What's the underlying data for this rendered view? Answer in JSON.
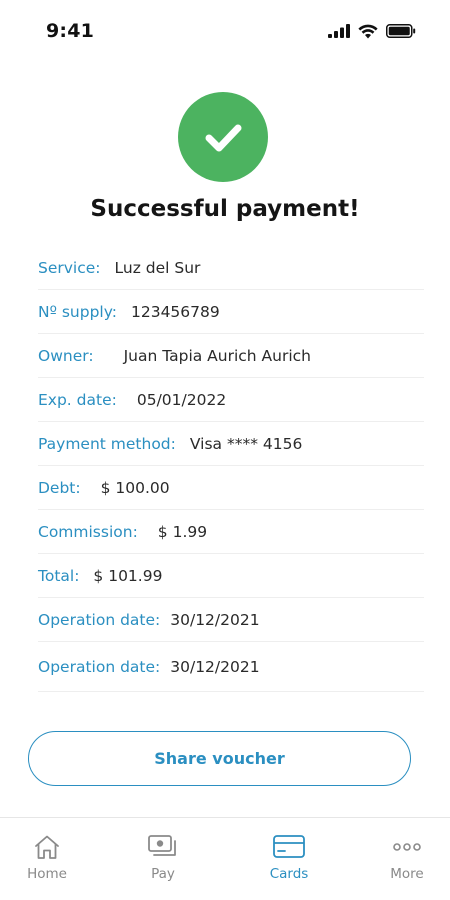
{
  "status_bar": {
    "time": "9:41"
  },
  "title": "Successful payment!",
  "details": [
    {
      "label": "Service:",
      "value": "Luz del Sur"
    },
    {
      "label": "Nº supply:",
      "value": "123456789"
    },
    {
      "label": "Owner:",
      "value": "Juan Tapia Aurich Aurich"
    },
    {
      "label": "Exp. date:",
      "value": "05/01/2022"
    },
    {
      "label": "Payment method:",
      "value": "Visa **** 4156"
    },
    {
      "label": "Debt:",
      "value": "$ 100.00"
    },
    {
      "label": "Commission:",
      "value": "$ 1.99"
    },
    {
      "label": "Total:",
      "value": "$ 101.99"
    },
    {
      "label": "Operation date:",
      "value": "30/12/2021"
    },
    {
      "label": "Operation date:",
      "value": "30/12/2021"
    }
  ],
  "share_button": {
    "label": "Share voucher"
  },
  "nav": {
    "items": [
      {
        "label": "Home",
        "icon": "home-icon",
        "active": false
      },
      {
        "label": "Pay",
        "icon": "pay-icon",
        "active": false
      },
      {
        "label": "Cards",
        "icon": "card-icon",
        "active": true
      },
      {
        "label": "More",
        "icon": "more-icon",
        "active": false
      }
    ]
  },
  "colors": {
    "accent": "#2b8fc1",
    "success": "#4cb360",
    "inactive": "#8a8a8a"
  }
}
